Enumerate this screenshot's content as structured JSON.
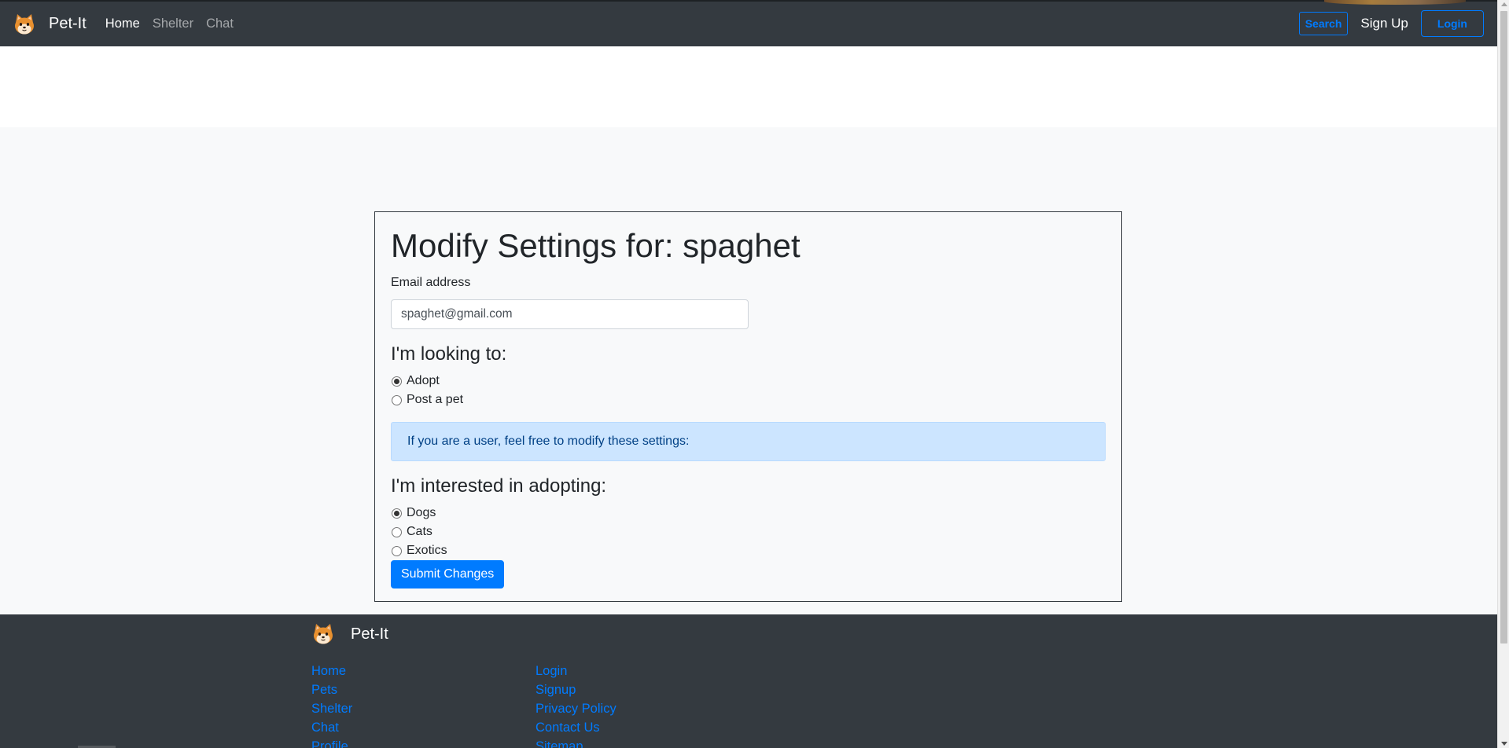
{
  "navbar": {
    "brand": "Pet-It",
    "logo_icon": "shiba-dog-face-icon",
    "links": [
      {
        "label": "Home",
        "active": true
      },
      {
        "label": "Shelter",
        "active": false
      },
      {
        "label": "Chat",
        "active": false
      }
    ],
    "search_label": "Search",
    "signup_label": "Sign Up",
    "login_label": "Login"
  },
  "settings": {
    "title": "Modify Settings for: spaghet",
    "email_label": "Email address",
    "email_value": "spaghet@gmail.com",
    "looking_title": "I'm looking to:",
    "looking_options": [
      {
        "label": "Adopt",
        "checked": true
      },
      {
        "label": "Post a pet",
        "checked": false
      }
    ],
    "info_alert": "If you are a user, feel free to modify these settings:",
    "interest_title": "I'm interested in adopting:",
    "interest_options": [
      {
        "label": "Dogs",
        "checked": true
      },
      {
        "label": "Cats",
        "checked": false
      },
      {
        "label": "Exotics",
        "checked": false
      }
    ],
    "submit_label": "Submit Changes"
  },
  "footer": {
    "brand": "Pet-It",
    "col1": [
      "Home",
      "Pets",
      "Shelter",
      "Chat",
      "Profile"
    ],
    "col2": [
      "Login",
      "Signup",
      "Privacy Policy",
      "Contact Us",
      "Sitemap"
    ]
  },
  "colors": {
    "navbar_bg": "#343a40",
    "primary": "#007bff",
    "page_bg": "#f8f9fa",
    "alert_bg": "#cce5ff"
  }
}
